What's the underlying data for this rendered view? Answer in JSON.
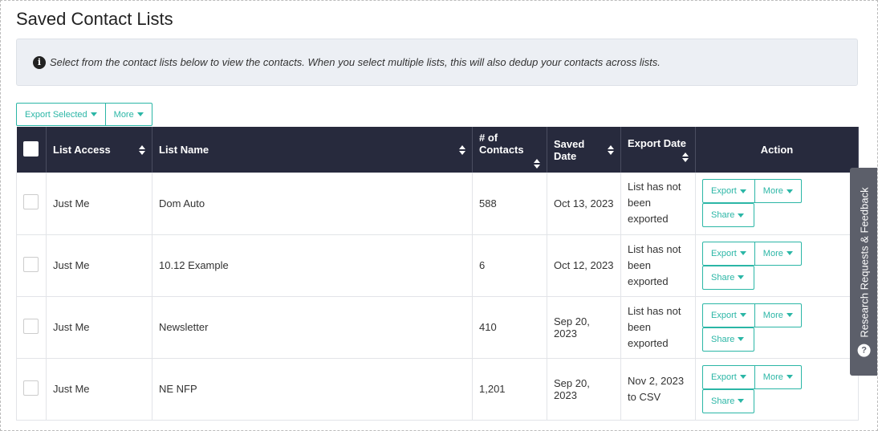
{
  "page": {
    "title": "Saved Contact Lists",
    "info_text": "Select from the contact lists below to view the contacts. When you select multiple lists, this will also dedup your contacts across lists."
  },
  "toolbar": {
    "export_selected_label": "Export Selected",
    "more_label": "More"
  },
  "table": {
    "columns": {
      "list_access": "List Access",
      "list_name": "List Name",
      "contacts": "# of Contacts",
      "saved_date": "Saved Date",
      "export_date": "Export Date",
      "action": "Action"
    },
    "rows": [
      {
        "access": "Just Me",
        "name": "Dom Auto",
        "contacts": "588",
        "saved": "Oct 13, 2023",
        "export_date": "List has not been exported"
      },
      {
        "access": "Just Me",
        "name": "10.12 Example",
        "contacts": "6",
        "saved": "Oct 12, 2023",
        "export_date": "List has not been exported"
      },
      {
        "access": "Just Me",
        "name": "Newsletter",
        "contacts": "410",
        "saved": "Sep 20, 2023",
        "export_date": "List has not been exported"
      },
      {
        "access": "Just Me",
        "name": "NE NFP",
        "contacts": "1,201",
        "saved": "Sep 20, 2023",
        "export_date": "Nov 2, 2023 to CSV"
      }
    ],
    "row_actions": {
      "export_label": "Export",
      "more_label": "More",
      "share_label": "Share"
    }
  },
  "feedback_tab": {
    "label": "Research Requests & Feedback",
    "icon": "question-circle-icon"
  },
  "colors": {
    "header_bg": "#272a3d",
    "accent": "#2bb6a6",
    "info_bg": "#eceff4",
    "feedback_bg": "#5c5f6a"
  }
}
